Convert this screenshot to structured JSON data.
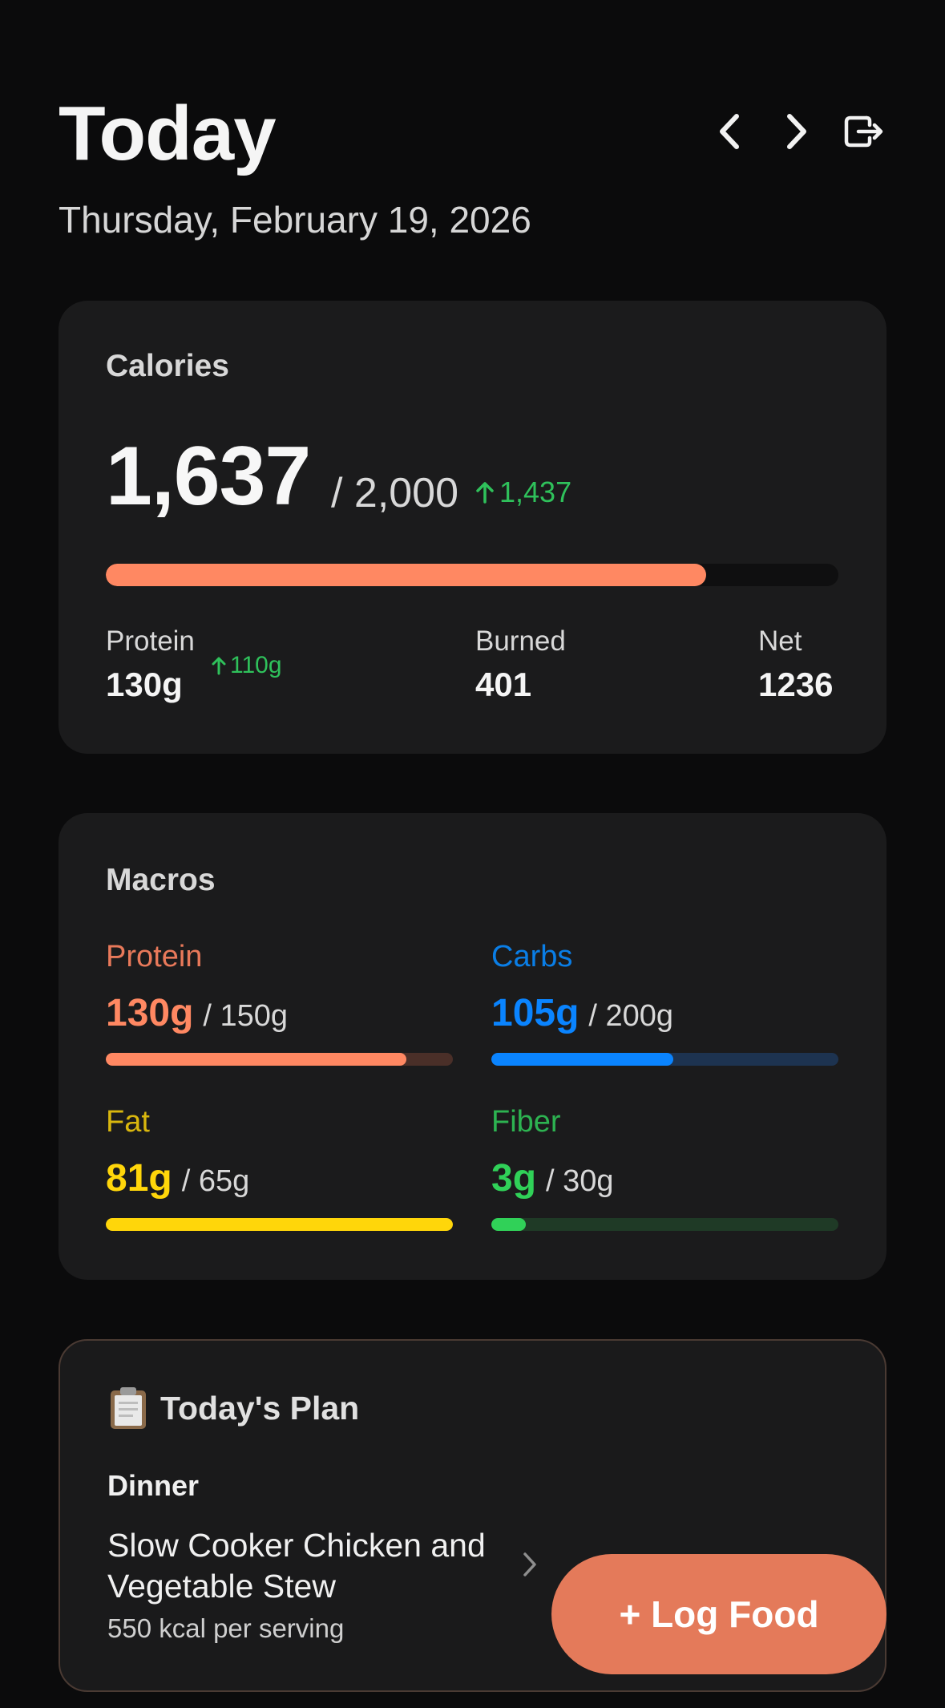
{
  "header": {
    "title": "Today",
    "date": "Thursday, February 19, 2026"
  },
  "calories": {
    "label": "Calories",
    "consumed": "1,637",
    "goal": "/ 2,000",
    "remaining": "1,437",
    "progress": 0.82,
    "bar_color": "#ff8862",
    "stats": [
      {
        "label": "Protein",
        "value": "130g",
        "delta": "110g"
      },
      {
        "label": "Burned",
        "value": "401"
      },
      {
        "label": "Net",
        "value": "1236"
      }
    ]
  },
  "macros": {
    "label": "Macros",
    "items": [
      {
        "name": "Protein",
        "value": "130g",
        "goal": "/ 150g",
        "progress": 0.867,
        "color": "#ff8862",
        "track": "#4a2f28"
      },
      {
        "name": "Carbs",
        "value": "105g",
        "goal": "/ 200g",
        "progress": 0.525,
        "color": "#0a84ff",
        "track": "#1d3350"
      },
      {
        "name": "Fat",
        "value": "81g",
        "goal": "/ 65g",
        "progress": 1.0,
        "color": "#ffd60a",
        "track": "#4a421a"
      },
      {
        "name": "Fiber",
        "value": "3g",
        "goal": "/ 30g",
        "progress": 0.1,
        "color": "#30d158",
        "track": "#1f3a26"
      }
    ]
  },
  "plan": {
    "icon": "clipboard-icon",
    "title": "Today's Plan",
    "meal_type": "Dinner",
    "meal_name": "Slow Cooker Chicken and Vegetable Stew",
    "meal_kcal": "550 kcal per serving"
  },
  "fab": {
    "label": "+ Log Food"
  },
  "colors": {
    "accent": "#e47a5a",
    "positive": "#2fc15b"
  }
}
